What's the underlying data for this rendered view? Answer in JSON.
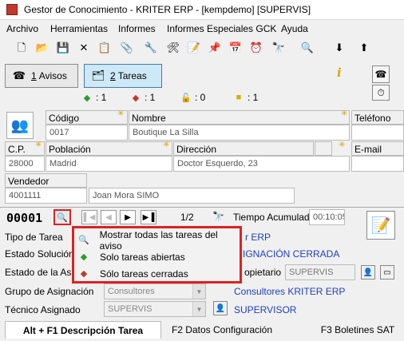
{
  "window": {
    "title": "Gestor de Conocimiento - KRITER ERP - [kempdemo] [SUPERVIS]"
  },
  "menu": [
    "Archivo",
    "Herramientas",
    "Informes",
    "Informes Especiales GCK",
    "Ayuda"
  ],
  "toolbar": {
    "icons": [
      "new-icon",
      "open-folder-icon",
      "save-icon",
      "delete-icon",
      "copy-icon",
      "attach-icon",
      "tools-icon",
      "note-icon",
      "calendar-icon",
      "clock-icon",
      "binoculars-icon",
      "search-icon",
      "down-arrow-icon",
      "up-arrow-icon"
    ]
  },
  "tabs": {
    "avisos": {
      "number": "1",
      "label": "Avisos"
    },
    "tareas": {
      "number": "2",
      "label": "Tareas"
    }
  },
  "info_mark": "i",
  "counters": [
    {
      "icon": "green-task-icon",
      "value": ": 1"
    },
    {
      "icon": "red-task-icon",
      "value": ": 1"
    },
    {
      "icon": "lock-icon",
      "value": ": 0"
    },
    {
      "icon": "yellow-note-icon",
      "value": ": 1"
    }
  ],
  "labels": {
    "codigo": "Código",
    "nombre": "Nombre",
    "telefono": "Teléfono",
    "cp": "C.P.",
    "poblacion": "Población",
    "direccion": "Dirección",
    "email": "E-mail",
    "vendedor": "Vendedor"
  },
  "values": {
    "codigo": "0017",
    "nombre": "Boutique La Silla",
    "cp": "28000",
    "poblacion": "Madrid",
    "direccion": "Doctor Esquerdo, 23",
    "vendedor_code": "4001111",
    "vendedor_name": "Joan Mora SIMO"
  },
  "task": {
    "number": "00001",
    "page": "1/2",
    "tiempo_label": "Tiempo Acumulado",
    "tiempo_value": "00:10:05"
  },
  "form_labels": {
    "tipo": "Tipo de Tarea",
    "estado_sol": "Estado Solución",
    "estado_asig": "Estado de la Asig",
    "grupo": "Grupo de Asignación",
    "tecnico": "Técnico Asignado",
    "propietario": "opietario"
  },
  "form_values": {
    "tipo_right": "r ERP",
    "estado_sol_right": "IGNACIÓN CERRADA",
    "propietario": "SUPERVIS",
    "grupo_select": "Consultores",
    "grupo_right": "Consultores KRITER ERP",
    "tecnico_select": "SUPERVIS",
    "tecnico_right": "SUPERVISOR"
  },
  "dropdown": [
    {
      "icon": "search-icon",
      "label": "Mostrar todas las tareas del aviso"
    },
    {
      "icon": "green-task-icon",
      "label": "Solo tareas abiertas"
    },
    {
      "icon": "red-task-icon",
      "label": "Sólo tareas cerradas"
    }
  ],
  "bottom_tabs": [
    "Alt + F1 Descripción Tarea",
    "F2 Datos Configuración",
    "F3 Boletines SAT"
  ],
  "colors": {
    "highlight_red": "#e02020",
    "tab_active_bg": "#cde8f6",
    "link_blue": "#1f3fbf"
  }
}
